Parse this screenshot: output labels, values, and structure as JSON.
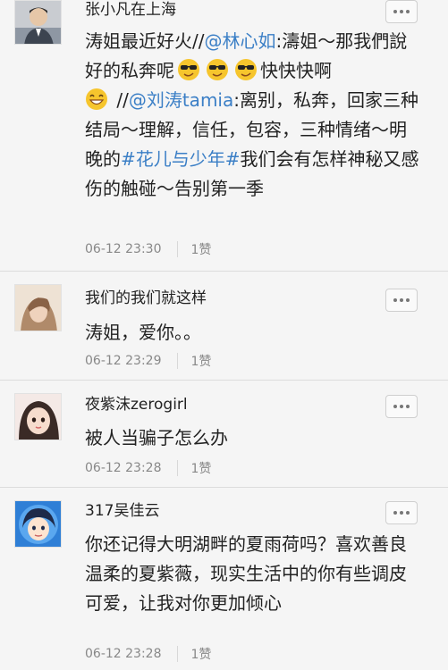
{
  "comments": [
    {
      "username": "张小凡在上海",
      "body": {
        "p1": "涛姐最近好火//",
        "m1": "@林心如",
        "p2": ":濤姐～那我們說好的私奔呢",
        "p3": "快快快啊",
        "p4": " //",
        "m2": "@刘涛tamia",
        "p5": ":离别，私奔，回家三种结局～理解，信任，包容，三种情绪～明晚的",
        "topic": "#花儿与少年#",
        "p6": "我们会有怎样神秘又感伤的触碰～告别第一季"
      },
      "time": "06-12 23:30",
      "likes": "1赞"
    },
    {
      "username": "我们的我们就这样",
      "body": "涛姐，爱你。。",
      "time": "06-12 23:29",
      "likes": "1赞"
    },
    {
      "username": "夜紫沫zerogirl",
      "body": "被人当骗子怎么办",
      "time": "06-12 23:28",
      "likes": "1赞"
    },
    {
      "username": "317吴佳云",
      "body": "你还记得大明湖畔的夏雨荷吗？喜欢善良温柔的夏紫薇，现实生活中的你有些调皮可爱，让我对你更加倾心",
      "time": "06-12 23:28",
      "likes": "1赞"
    }
  ],
  "icons": {
    "more": "more-options-icon",
    "emoji_cool": "sunglasses-emoji-icon",
    "emoji_grin": "grin-emoji-icon"
  },
  "colors": {
    "link": "#3b7fc6",
    "text": "#222222",
    "meta": "#888888",
    "background": "#f5f5f5"
  }
}
